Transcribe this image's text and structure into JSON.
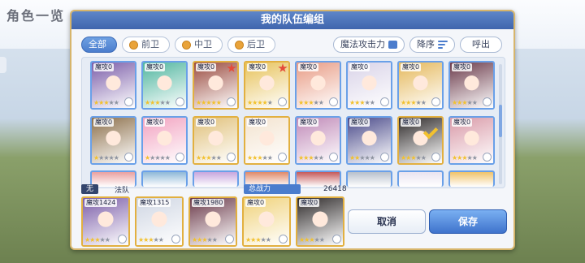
{
  "background": {
    "title": "角色一览"
  },
  "dialog": {
    "title": "我的队伍编组"
  },
  "filters": [
    {
      "label": "全部",
      "active": true
    },
    {
      "label": "前卫",
      "active": false
    },
    {
      "label": "中卫",
      "active": false
    },
    {
      "label": "后卫",
      "active": false
    }
  ],
  "sort": {
    "attribute_label": "魔法攻击力",
    "order_label": "降序",
    "summon_label": "呼出"
  },
  "grid": {
    "row1": [
      {
        "lvl": "魔攻0",
        "stars": 3,
        "color": "#7b5da8",
        "gold": false,
        "badge": false
      },
      {
        "lvl": "魔攻0",
        "stars": 3,
        "color": "#4fb59e",
        "gold": false,
        "badge": false
      },
      {
        "lvl": "魔攻0",
        "stars": 5,
        "color": "#9a4b3f",
        "gold": true,
        "badge": true
      },
      {
        "lvl": "魔攻0",
        "stars": 4,
        "color": "#e7c25a",
        "gold": true,
        "badge": true
      },
      {
        "lvl": "魔攻0",
        "stars": 3,
        "color": "#e89b84",
        "gold": false,
        "badge": false
      },
      {
        "lvl": "魔攻0",
        "stars": 3,
        "color": "#d9d3e8",
        "gold": false,
        "badge": false
      },
      {
        "lvl": "魔攻0",
        "stars": 3,
        "color": "#e5b85b",
        "gold": false,
        "badge": false
      },
      {
        "lvl": "魔攻0",
        "stars": 3,
        "color": "#6b3a4a",
        "gold": false,
        "badge": false
      }
    ],
    "row2": [
      {
        "lvl": "魔攻0",
        "stars": 1,
        "color": "#8c6f4a",
        "gold": false,
        "badge": false
      },
      {
        "lvl": "魔攻0",
        "stars": 1,
        "color": "#f2a2c0",
        "gold": false,
        "badge": false
      },
      {
        "lvl": "魔攻0",
        "stars": 3,
        "color": "#e0c07a",
        "gold": true,
        "badge": false
      },
      {
        "lvl": "魔攻0",
        "stars": 3,
        "color": "#f3e3cf",
        "gold": true,
        "badge": false
      },
      {
        "lvl": "魔攻0",
        "stars": 3,
        "color": "#c08ab8",
        "gold": false,
        "badge": false
      },
      {
        "lvl": "魔攻0",
        "stars": 2,
        "color": "#4a4a8a",
        "gold": false,
        "badge": false
      },
      {
        "lvl": "魔攻0",
        "stars": 3,
        "color": "#2e2a2a",
        "gold": true,
        "badge": false,
        "check": true
      },
      {
        "lvl": "魔攻0",
        "stars": 3,
        "color": "#d99aa8",
        "gold": false,
        "badge": false
      }
    ],
    "row3_colors": [
      "#e9a0a0",
      "#8fb8d8",
      "#c7a6de",
      "#e08a6a",
      "#c55a5a",
      "#b7c0cc",
      "#e9e3f0",
      "#f0c36a"
    ]
  },
  "team": {
    "tag": "无",
    "name": "法队",
    "power_label": "总战力",
    "power_value": "26418",
    "members": [
      {
        "lvl": "魔攻1424",
        "stars": 3,
        "color": "#7b5da8"
      },
      {
        "lvl": "魔攻1315",
        "stars": 3,
        "color": "#cfd6e3"
      },
      {
        "lvl": "魔攻1980",
        "stars": 3,
        "color": "#6b3a4a"
      },
      {
        "lvl": "魔攻0",
        "stars": 3,
        "color": "#f0d27a"
      },
      {
        "lvl": "魔攻0",
        "stars": 3,
        "color": "#2e2a2a"
      }
    ]
  },
  "buttons": {
    "cancel": "取消",
    "save": "保存"
  }
}
